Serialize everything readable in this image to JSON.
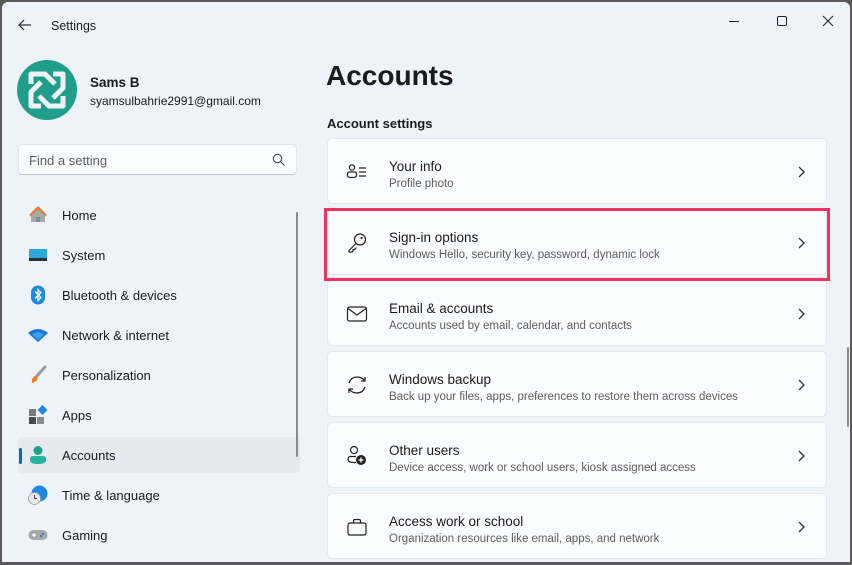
{
  "window": {
    "title": "Settings",
    "controls": {
      "minimize": "minimize",
      "maximize": "maximize",
      "close": "close"
    }
  },
  "profile": {
    "name": "Sams B",
    "email": "syamsulbahrie2991@gmail.com",
    "avatar_color": "#1f9e8c"
  },
  "search": {
    "placeholder": "Find a setting",
    "value": ""
  },
  "sidebar": {
    "items": [
      {
        "label": "Home",
        "icon": "home-icon",
        "active": false
      },
      {
        "label": "System",
        "icon": "system-icon",
        "active": false
      },
      {
        "label": "Bluetooth & devices",
        "icon": "bluetooth-icon",
        "active": false
      },
      {
        "label": "Network & internet",
        "icon": "network-icon",
        "active": false
      },
      {
        "label": "Personalization",
        "icon": "personalization-icon",
        "active": false
      },
      {
        "label": "Apps",
        "icon": "apps-icon",
        "active": false
      },
      {
        "label": "Accounts",
        "icon": "accounts-icon",
        "active": true
      },
      {
        "label": "Time & language",
        "icon": "time-language-icon",
        "active": false
      },
      {
        "label": "Gaming",
        "icon": "gaming-icon",
        "active": false
      }
    ]
  },
  "main": {
    "title": "Accounts",
    "section": "Account settings",
    "highlight_color": "#f0325e",
    "cards": [
      {
        "title": "Your info",
        "subtitle": "Profile photo",
        "icon": "your-info-icon"
      },
      {
        "title": "Sign-in options",
        "subtitle": "Windows Hello, security key, password, dynamic lock",
        "icon": "key-icon",
        "highlighted": true
      },
      {
        "title": "Email & accounts",
        "subtitle": "Accounts used by email, calendar, and contacts",
        "icon": "mail-icon"
      },
      {
        "title": "Windows backup",
        "subtitle": "Back up your files, apps, preferences to restore them across devices",
        "icon": "sync-icon"
      },
      {
        "title": "Other users",
        "subtitle": "Device access, work or school users, kiosk assigned access",
        "icon": "add-user-icon"
      },
      {
        "title": "Access work or school",
        "subtitle": "Organization resources like email, apps, and network",
        "icon": "briefcase-icon"
      }
    ]
  }
}
